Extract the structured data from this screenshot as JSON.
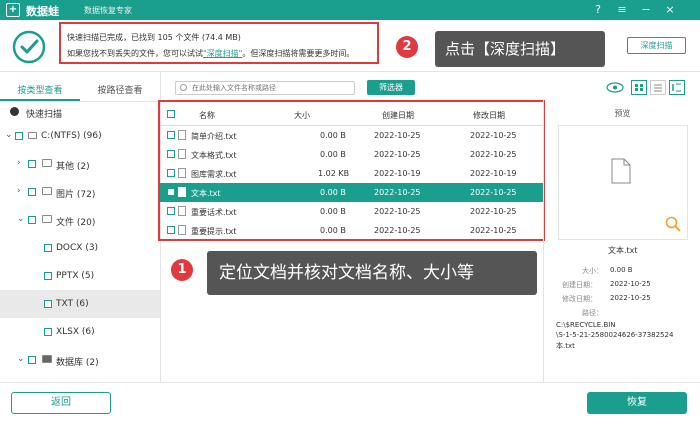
{
  "app": {
    "name": "数据蛙",
    "subtitle": "数据恢复专家"
  },
  "header": {
    "line1": "快速扫描已完成，已找到 105 个文件 (74.4 MB)",
    "line2_prefix": "如果您找不到丢失的文件，您可以试试",
    "line2_link": "\"深度扫描\"",
    "line2_suffix": "。但深度扫描将需要更多时间。",
    "deep_scan_button": "深度扫描"
  },
  "annotations": [
    {
      "number": "2",
      "text": "点击【深度扫描】"
    },
    {
      "number": "1",
      "text": "定位文档并核对文档名称、大小等"
    }
  ],
  "left_tabs": [
    "按类型查看",
    "按路径查看"
  ],
  "tree": [
    {
      "label": "快速扫描"
    },
    {
      "label": "C:(NTFS) (96)"
    },
    {
      "label": "其他 (2)"
    },
    {
      "label": "图片 (72)"
    },
    {
      "label": "文件 (20)"
    },
    {
      "label": "DOCX (3)"
    },
    {
      "label": "PPTX (5)"
    },
    {
      "label": "TXT (6)"
    },
    {
      "label": "XLSX (6)"
    },
    {
      "label": "数据库 (2)"
    }
  ],
  "search": {
    "placeholder": "在此处输入文件名称或路径"
  },
  "filter_button": "筛选器",
  "table": {
    "headers": [
      "名称",
      "大小",
      "创建日期",
      "修改日期"
    ],
    "rows": [
      {
        "name": "简单介绍.txt",
        "size": "0.00  B",
        "created": "2022-10-25",
        "modified": "2022-10-25"
      },
      {
        "name": "文本格式.txt",
        "size": "0.00  B",
        "created": "2022-10-25",
        "modified": "2022-10-25"
      },
      {
        "name": "图库需求.txt",
        "size": "1.02 KB",
        "created": "2022-10-19",
        "modified": "2022-10-19"
      },
      {
        "name": "文本.txt",
        "size": "0.00  B",
        "created": "2022-10-25",
        "modified": "2022-10-25"
      },
      {
        "name": "重要话术.txt",
        "size": "0.00  B",
        "created": "2022-10-25",
        "modified": "2022-10-25"
      },
      {
        "name": "重要提示.txt",
        "size": "0.00  B",
        "created": "2022-10-25",
        "modified": "2022-10-25"
      }
    ]
  },
  "preview": {
    "title": "预览",
    "filename": "文本.txt",
    "size_label": "大小：",
    "size_value": "0.00  B",
    "created_label": "创建日期：",
    "created_value": "2022-10-25",
    "modified_label": "修改日期：",
    "modified_value": "2022-10-25",
    "path_label": "路径：",
    "path_value_1": "C:\\$RECYCLE.BIN",
    "path_value_2": "\\S-1-5-21-2580024626-37382524",
    "path_value_3": "本.txt"
  },
  "footer": {
    "back": "返回",
    "recover": "恢复"
  },
  "colors": {
    "accent": "#1a9e8e",
    "highlight": "#e0393e",
    "tooltip": "#555555"
  }
}
